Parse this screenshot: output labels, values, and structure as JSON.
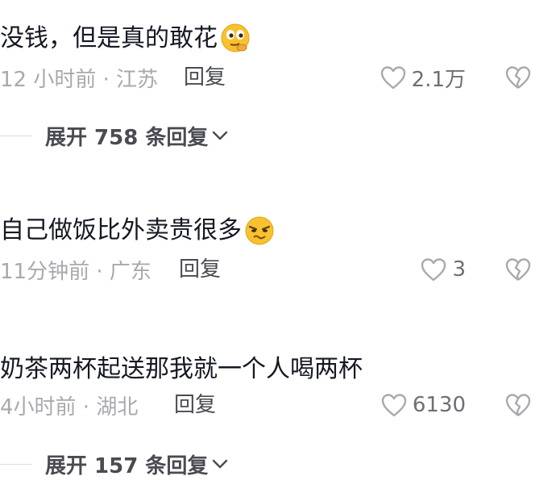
{
  "comments": [
    {
      "text": "没钱，但是真的敢花",
      "emoji": "thinking-face-emoji",
      "meta": "12 小时前 · 江苏",
      "reply_label": "回复",
      "likes": "2.1万",
      "expand_label": "展开 758 条回复"
    },
    {
      "text": "自己做饭比外卖贵很多",
      "emoji": "smirk-face-emoji",
      "meta": "11分钟前 · 广东",
      "reply_label": "回复",
      "likes": "3"
    },
    {
      "text": "奶茶两杯起送那我就一个人喝两杯",
      "meta": "4小时前 · 湖北",
      "reply_label": "回复",
      "likes": "6130",
      "expand_label": "展开 157 条回复"
    }
  ],
  "colors": {
    "text_primary": "#161823",
    "text_meta": "#a8a9ae",
    "text_action": "#4a4b52",
    "icon": "#a8a9ae",
    "emoji_yellow": "#f7c12f"
  },
  "icons": {
    "like": "heart-outline-icon",
    "dislike": "broken-heart-icon",
    "expand": "chevron-down-icon"
  }
}
